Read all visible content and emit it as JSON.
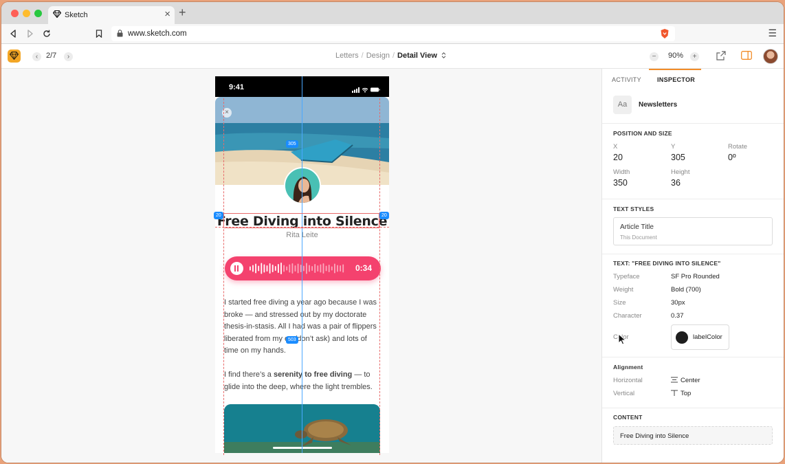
{
  "browser": {
    "tab_title": "Sketch",
    "new_tab_symbol": "+",
    "close_symbol": "×",
    "url": "www.sketch.com",
    "menu_symbol": "☰"
  },
  "toolbar": {
    "page_count": "2/7",
    "breadcrumbs": [
      "Letters",
      "Design"
    ],
    "current_view": "Detail View",
    "zoom": "90%",
    "zoom_out_symbol": "−",
    "zoom_in_symbol": "+"
  },
  "artboard": {
    "status_time": "9:41",
    "article_title": "Free Diving into Silence",
    "author": "Rita Leite",
    "audio_duration": "0:34",
    "paragraph1": "I started free diving a year ago because I was broke — and stressed out by my doctorate thesis-in-stasis. All I had was a pair of flippers liberated from my ex (don’t ask) and lots of time on my hands.",
    "paragraph2_pre": "I find there’s a ",
    "paragraph2_bold": "serenity to free diving",
    "paragraph2_post": " — to glide into the deep, where the light trembles."
  },
  "measurements": {
    "top_distance": "305",
    "left_margin": "20",
    "right_margin": "20",
    "bottom_distance": "503"
  },
  "inspector": {
    "tabs": [
      "ACTIVITY",
      "INSPECTOR"
    ],
    "active_tab": "INSPECTOR",
    "layer_icon_text": "Aa",
    "layer_name": "Newsletters",
    "position_section": "POSITION AND SIZE",
    "x_label": "X",
    "x_value": "20",
    "y_label": "Y",
    "y_value": "305",
    "rotate_label": "Rotate",
    "rotate_value": "0º",
    "width_label": "Width",
    "width_value": "350",
    "height_label": "Height",
    "height_value": "36",
    "text_styles_section": "TEXT STYLES",
    "style_name": "Article Title",
    "style_source": "This Document",
    "text_section": "TEXT: \"FREE DIVING INTO SILENCE\"",
    "typeface_label": "Typeface",
    "typeface_value": "SF Pro Rounded",
    "weight_label": "Weight",
    "weight_value": "Bold (700)",
    "size_label": "Size",
    "size_value": "30px",
    "character_label": "Character",
    "character_value": "0.37",
    "color_label": "Color",
    "color_value": "labelColor",
    "alignment_section": "Alignment",
    "horizontal_label": "Horizontal",
    "horizontal_value": "Center",
    "vertical_label": "Vertical",
    "vertical_value": "Top",
    "content_section": "CONTENT",
    "content_value": "Free Diving into Silence"
  },
  "colors": {
    "accent_orange": "#f28c28",
    "sketch_logo": "#f3a626",
    "player_pink": "#f4426e",
    "measure_blue": "#1a8cff",
    "guide_red": "#e86a6a"
  },
  "icons": [
    "sketch-logo-icon",
    "back-icon",
    "forward-icon",
    "reload-icon",
    "bookmark-icon",
    "lock-icon",
    "brave-shield-icon",
    "chevron-updown-icon",
    "share-icon",
    "sidebar-icon",
    "pause-icon",
    "waveform-icon",
    "cursor-icon"
  ]
}
